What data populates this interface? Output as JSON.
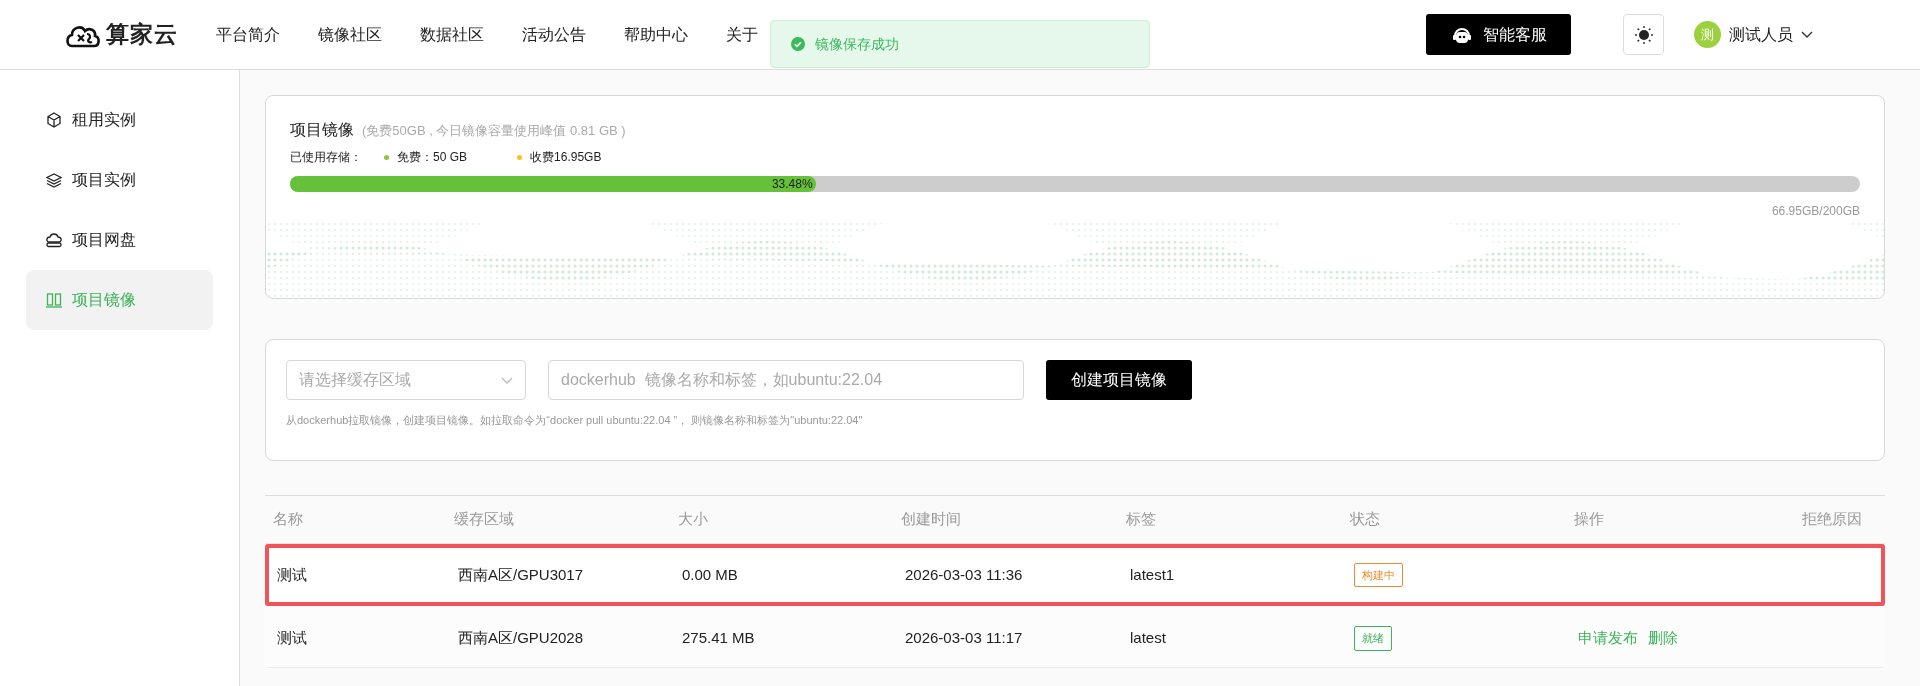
{
  "header": {
    "logo": "算家云",
    "nav": [
      "平台简介",
      "镜像社区",
      "数据社区",
      "活动公告",
      "帮助中心",
      "关于"
    ],
    "support_button": "智能客服",
    "user": {
      "avatar": "测",
      "name": "测试人员"
    }
  },
  "toast": {
    "kind": "success",
    "message": "镜像保存成功"
  },
  "sidebar": {
    "items": [
      {
        "label": "租用实例",
        "selected": false
      },
      {
        "label": "项目实例",
        "selected": false
      },
      {
        "label": "项目网盘",
        "selected": false
      },
      {
        "label": "项目镜像",
        "selected": true
      }
    ]
  },
  "storage": {
    "title": "项目镜像",
    "note": "(免费50GB , 今日镜像容量使用峰值 0.81 GB )",
    "legend_label": "已使用存储：",
    "legend": [
      {
        "label": "免费：50 GB",
        "color": "#8cc63f"
      },
      {
        "label": "收费16.95GB",
        "color": "#f5c518"
      }
    ],
    "level": 0.3348,
    "percent": "33.48%",
    "total": "66.95GB/200GB"
  },
  "create_form": {
    "region_placeholder": "请选择缓存区域",
    "image_placeholder": "dockerhub  镜像名称和标签，如ubuntu:22.04",
    "button": "创建项目镜像",
    "hint": "从dockerhub拉取镜像，创建项目镜像。如拉取命令为“docker pull ubuntu:22.04 ”， 则镜像名称和标签为\"ubuntu:22.04\""
  },
  "table": {
    "columns": [
      "名称",
      "缓存区域",
      "大小",
      "创建时间",
      "标签",
      "状态",
      "操作",
      "拒绝原因"
    ],
    "rows": [
      {
        "name": "测试",
        "region": "西南A区/GPU3017",
        "size": "0.00 MB",
        "created": "2026-03-03 11:36",
        "tag": "latest1",
        "status": {
          "kind": "building",
          "label": "构建中"
        },
        "actions": [],
        "highlighted": true
      },
      {
        "name": "测试",
        "region": "西南A区/GPU2028",
        "size": "275.41 MB",
        "created": "2026-03-03 11:17",
        "tag": "latest",
        "status": {
          "kind": "ready",
          "label": "就绪"
        },
        "actions": [
          "申请发布",
          "删除"
        ],
        "highlighted": false
      }
    ]
  }
}
